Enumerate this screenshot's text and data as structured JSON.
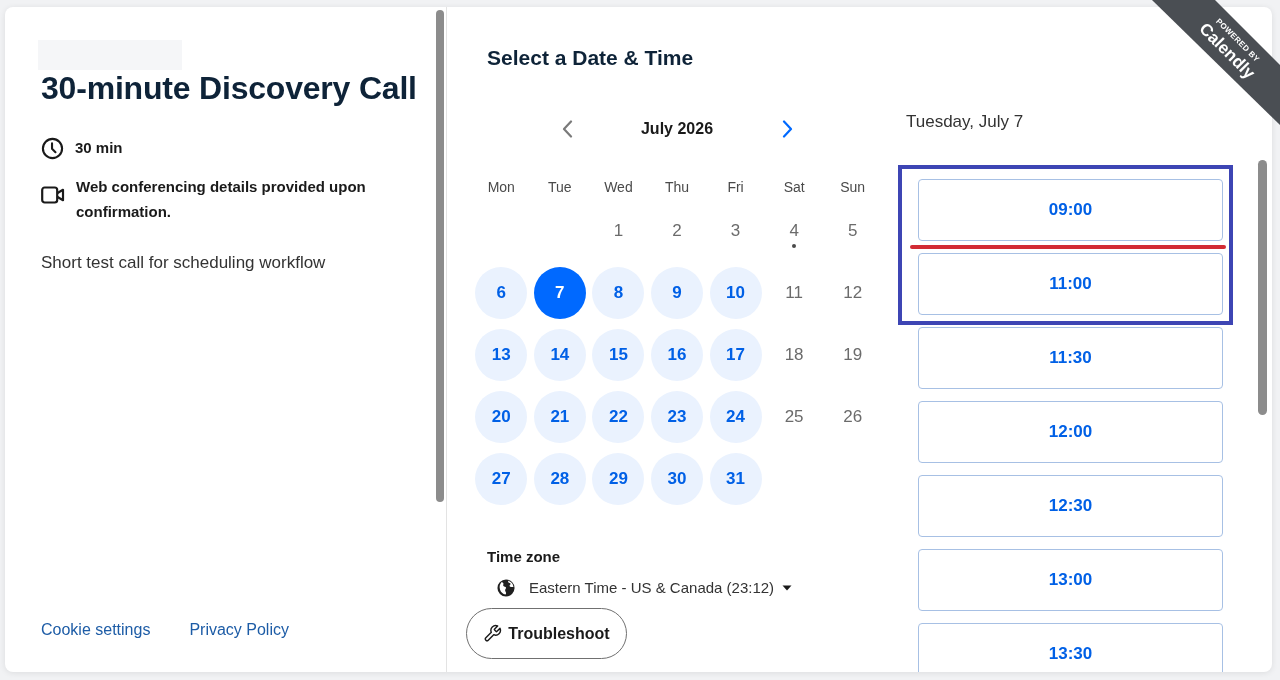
{
  "event": {
    "title": "30-minute Discovery Call",
    "duration": "30 min",
    "location_note": "Web conferencing details provided upon confirmation.",
    "description": "Short test call for scheduling workflow"
  },
  "footer_links": [
    "Cookie settings",
    "Privacy Policy"
  ],
  "scheduler": {
    "heading": "Select a Date & Time",
    "calendar": {
      "month": "July 2026",
      "prev_month": {
        "disabled": true
      },
      "next_month": {
        "disabled": false
      },
      "weekdays": [
        "Mon",
        "Tue",
        "Wed",
        "Thu",
        "Fri",
        "Sat",
        "Sun"
      ],
      "weeks": [
        [
          {
            "day": "1",
            "available": false,
            "selected": false,
            "today": false
          },
          {
            "day": "2",
            "available": false,
            "selected": false,
            "today": false
          },
          {
            "day": "3",
            "available": false,
            "selected": false,
            "today": false
          },
          {
            "day": "4",
            "available": false,
            "selected": false,
            "today": true
          },
          {
            "day": "5",
            "available": false,
            "selected": false,
            "today": false
          }
        ],
        [
          {
            "day": "6",
            "available": true,
            "selected": false,
            "today": false
          },
          {
            "day": "7",
            "available": true,
            "selected": true,
            "today": false
          },
          {
            "day": "8",
            "available": true,
            "selected": false,
            "today": false
          },
          {
            "day": "9",
            "available": true,
            "selected": false,
            "today": false
          },
          {
            "day": "10",
            "available": true,
            "selected": false,
            "today": false
          },
          {
            "day": "11",
            "available": false,
            "selected": false,
            "today": false
          },
          {
            "day": "12",
            "available": false,
            "selected": false,
            "today": false
          }
        ],
        [
          {
            "day": "13",
            "available": true,
            "selected": false,
            "today": false
          },
          {
            "day": "14",
            "available": true,
            "selected": false,
            "today": false
          },
          {
            "day": "15",
            "available": true,
            "selected": false,
            "today": false
          },
          {
            "day": "16",
            "available": true,
            "selected": false,
            "today": false
          },
          {
            "day": "17",
            "available": true,
            "selected": false,
            "today": false
          },
          {
            "day": "18",
            "available": false,
            "selected": false,
            "today": false
          },
          {
            "day": "19",
            "available": false,
            "selected": false,
            "today": false
          }
        ],
        [
          {
            "day": "20",
            "available": true,
            "selected": false,
            "today": false
          },
          {
            "day": "21",
            "available": true,
            "selected": false,
            "today": false
          },
          {
            "day": "22",
            "available": true,
            "selected": false,
            "today": false
          },
          {
            "day": "23",
            "available": true,
            "selected": false,
            "today": false
          },
          {
            "day": "24",
            "available": true,
            "selected": false,
            "today": false
          },
          {
            "day": "25",
            "available": false,
            "selected": false,
            "today": false
          },
          {
            "day": "26",
            "available": false,
            "selected": false,
            "today": false
          }
        ],
        [
          {
            "day": "27",
            "available": true,
            "selected": false,
            "today": false
          },
          {
            "day": "28",
            "available": true,
            "selected": false,
            "today": false
          },
          {
            "day": "29",
            "available": true,
            "selected": false,
            "today": false
          },
          {
            "day": "30",
            "available": true,
            "selected": false,
            "today": false
          },
          {
            "day": "31",
            "available": true,
            "selected": false,
            "today": false
          }
        ]
      ]
    },
    "time_zone": {
      "label": "Time zone",
      "value": "Eastern Time - US & Canada (23:12)"
    },
    "troubleshoot_button": "Troubleshoot"
  },
  "time_slots": {
    "date": "Tuesday, July 7",
    "slots": [
      {
        "time": "09:00",
        "framed": true,
        "line_below": true
      },
      {
        "time": "11:00",
        "framed": true,
        "line_below": false
      },
      {
        "time": "11:30",
        "framed": false,
        "line_below": false
      },
      {
        "time": "12:00",
        "framed": false,
        "line_below": false
      },
      {
        "time": "12:30",
        "framed": false,
        "line_below": false
      },
      {
        "time": "13:00",
        "framed": false,
        "line_below": false
      },
      {
        "time": "13:30",
        "framed": false,
        "line_below": false
      }
    ]
  },
  "ribbon": {
    "caption": "POWERED BY",
    "brand": "Calendly"
  }
}
